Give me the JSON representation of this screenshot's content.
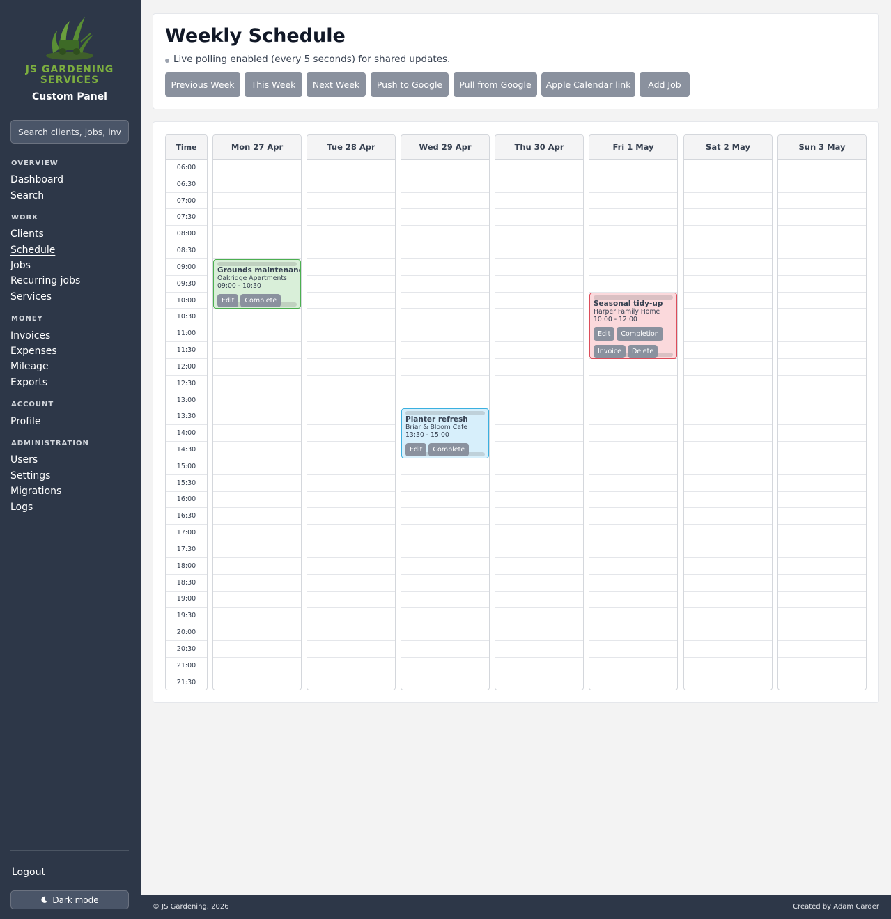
{
  "brand": {
    "name_line1": "JS GARDENING",
    "name_line2": "SERVICES",
    "panel_title": "Custom Panel"
  },
  "search": {
    "placeholder": "Search clients, jobs, invoices"
  },
  "nav": {
    "sections": [
      {
        "heading": "OVERVIEW",
        "items": [
          "Dashboard",
          "Search"
        ]
      },
      {
        "heading": "WORK",
        "items": [
          "Clients",
          "Schedule",
          "Jobs",
          "Recurring jobs",
          "Services"
        ]
      },
      {
        "heading": "MONEY",
        "items": [
          "Invoices",
          "Expenses",
          "Mileage",
          "Exports"
        ]
      },
      {
        "heading": "ACCOUNT",
        "items": [
          "Profile"
        ]
      },
      {
        "heading": "ADMINISTRATION",
        "items": [
          "Users",
          "Settings",
          "Migrations",
          "Logs"
        ]
      }
    ],
    "active": "Schedule",
    "logout": "Logout",
    "dark_mode": "Dark mode"
  },
  "header": {
    "title": "Weekly Schedule",
    "polling": "Live polling enabled (every 5 seconds) for shared updates.",
    "buttons": [
      "Previous Week",
      "This Week",
      "Next Week",
      "Push to Google",
      "Pull from Google",
      "Apple Calendar link",
      "Add Job"
    ]
  },
  "calendar": {
    "time_header": "Time",
    "days": [
      "Mon 27 Apr",
      "Tue 28 Apr",
      "Wed 29 Apr",
      "Thu 30 Apr",
      "Fri 1 May",
      "Sat 2 May",
      "Sun 3 May"
    ],
    "times": [
      "06:00",
      "06:30",
      "07:00",
      "07:30",
      "08:00",
      "08:30",
      "09:00",
      "09:30",
      "10:00",
      "10:30",
      "11:00",
      "11:30",
      "12:00",
      "12:30",
      "13:00",
      "13:30",
      "14:00",
      "14:30",
      "15:00",
      "15:30",
      "16:00",
      "16:30",
      "17:00",
      "17:30",
      "18:00",
      "18:30",
      "19:00",
      "19:30",
      "20:00",
      "20:30",
      "21:00",
      "21:30"
    ],
    "events": [
      {
        "day": 0,
        "start": "09:00",
        "end": "10:30",
        "title": "Grounds maintenance",
        "client": "Oakridge Apartments",
        "time": "09:00 - 10:30",
        "color": "green",
        "buttons": [
          "Edit",
          "Complete"
        ]
      },
      {
        "day": 2,
        "start": "13:30",
        "end": "15:00",
        "title": "Planter refresh",
        "client": "Briar & Bloom Cafe",
        "time": "13:30 - 15:00",
        "color": "blue",
        "buttons": [
          "Edit",
          "Complete"
        ]
      },
      {
        "day": 4,
        "start": "10:00",
        "end": "12:00",
        "title": "Seasonal tidy-up",
        "client": "Harper Family Home",
        "time": "10:00 - 12:00",
        "color": "red",
        "buttons": [
          "Edit",
          "Completion",
          "Invoice",
          "Delete"
        ]
      }
    ]
  },
  "footer": {
    "left": "© JS Gardening. 2026",
    "right": "Created by Adam Carder"
  },
  "colors": {
    "sidebar": "#2d3748",
    "brand_green": "#7cae3f",
    "button": "#8a919e"
  }
}
